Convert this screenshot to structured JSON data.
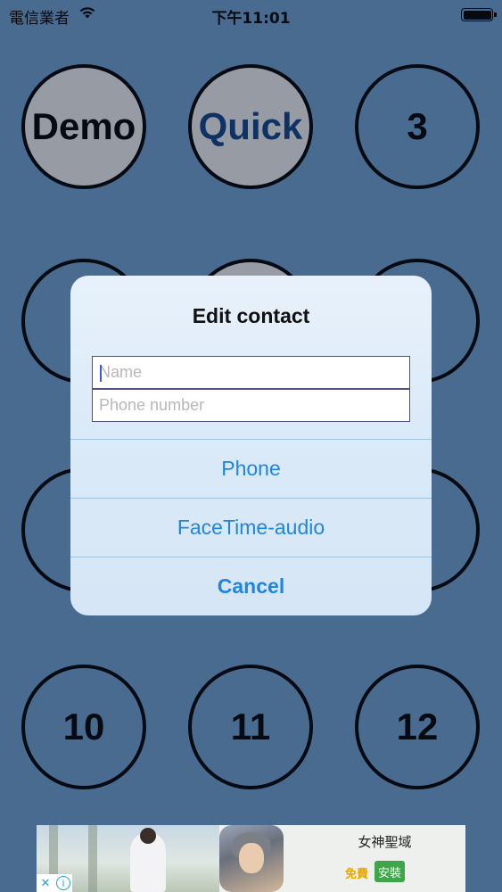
{
  "status_bar": {
    "carrier": "電信業者",
    "time": "下午11:01",
    "wifi_icon": "wifi-icon",
    "battery_icon": "battery-icon"
  },
  "grid": {
    "buttons": [
      "Demo",
      "Quick",
      "3",
      "",
      "",
      "",
      "",
      "",
      "",
      "10",
      "11",
      "12"
    ]
  },
  "alert": {
    "title": "Edit contact",
    "name_placeholder": "Name",
    "phone_placeholder": "Phone number",
    "actions": [
      "Phone",
      "FaceTime-audio",
      "Cancel"
    ]
  },
  "ad": {
    "title": "女神聖域",
    "tag": "免費",
    "install_label": "安裝",
    "close_icon": "✕",
    "info_icon": "i"
  },
  "colors": {
    "background": "#5f86ad",
    "action_blue": "#1f86e0",
    "quick_text": "#0c3770",
    "install_green": "#3ea54a"
  }
}
